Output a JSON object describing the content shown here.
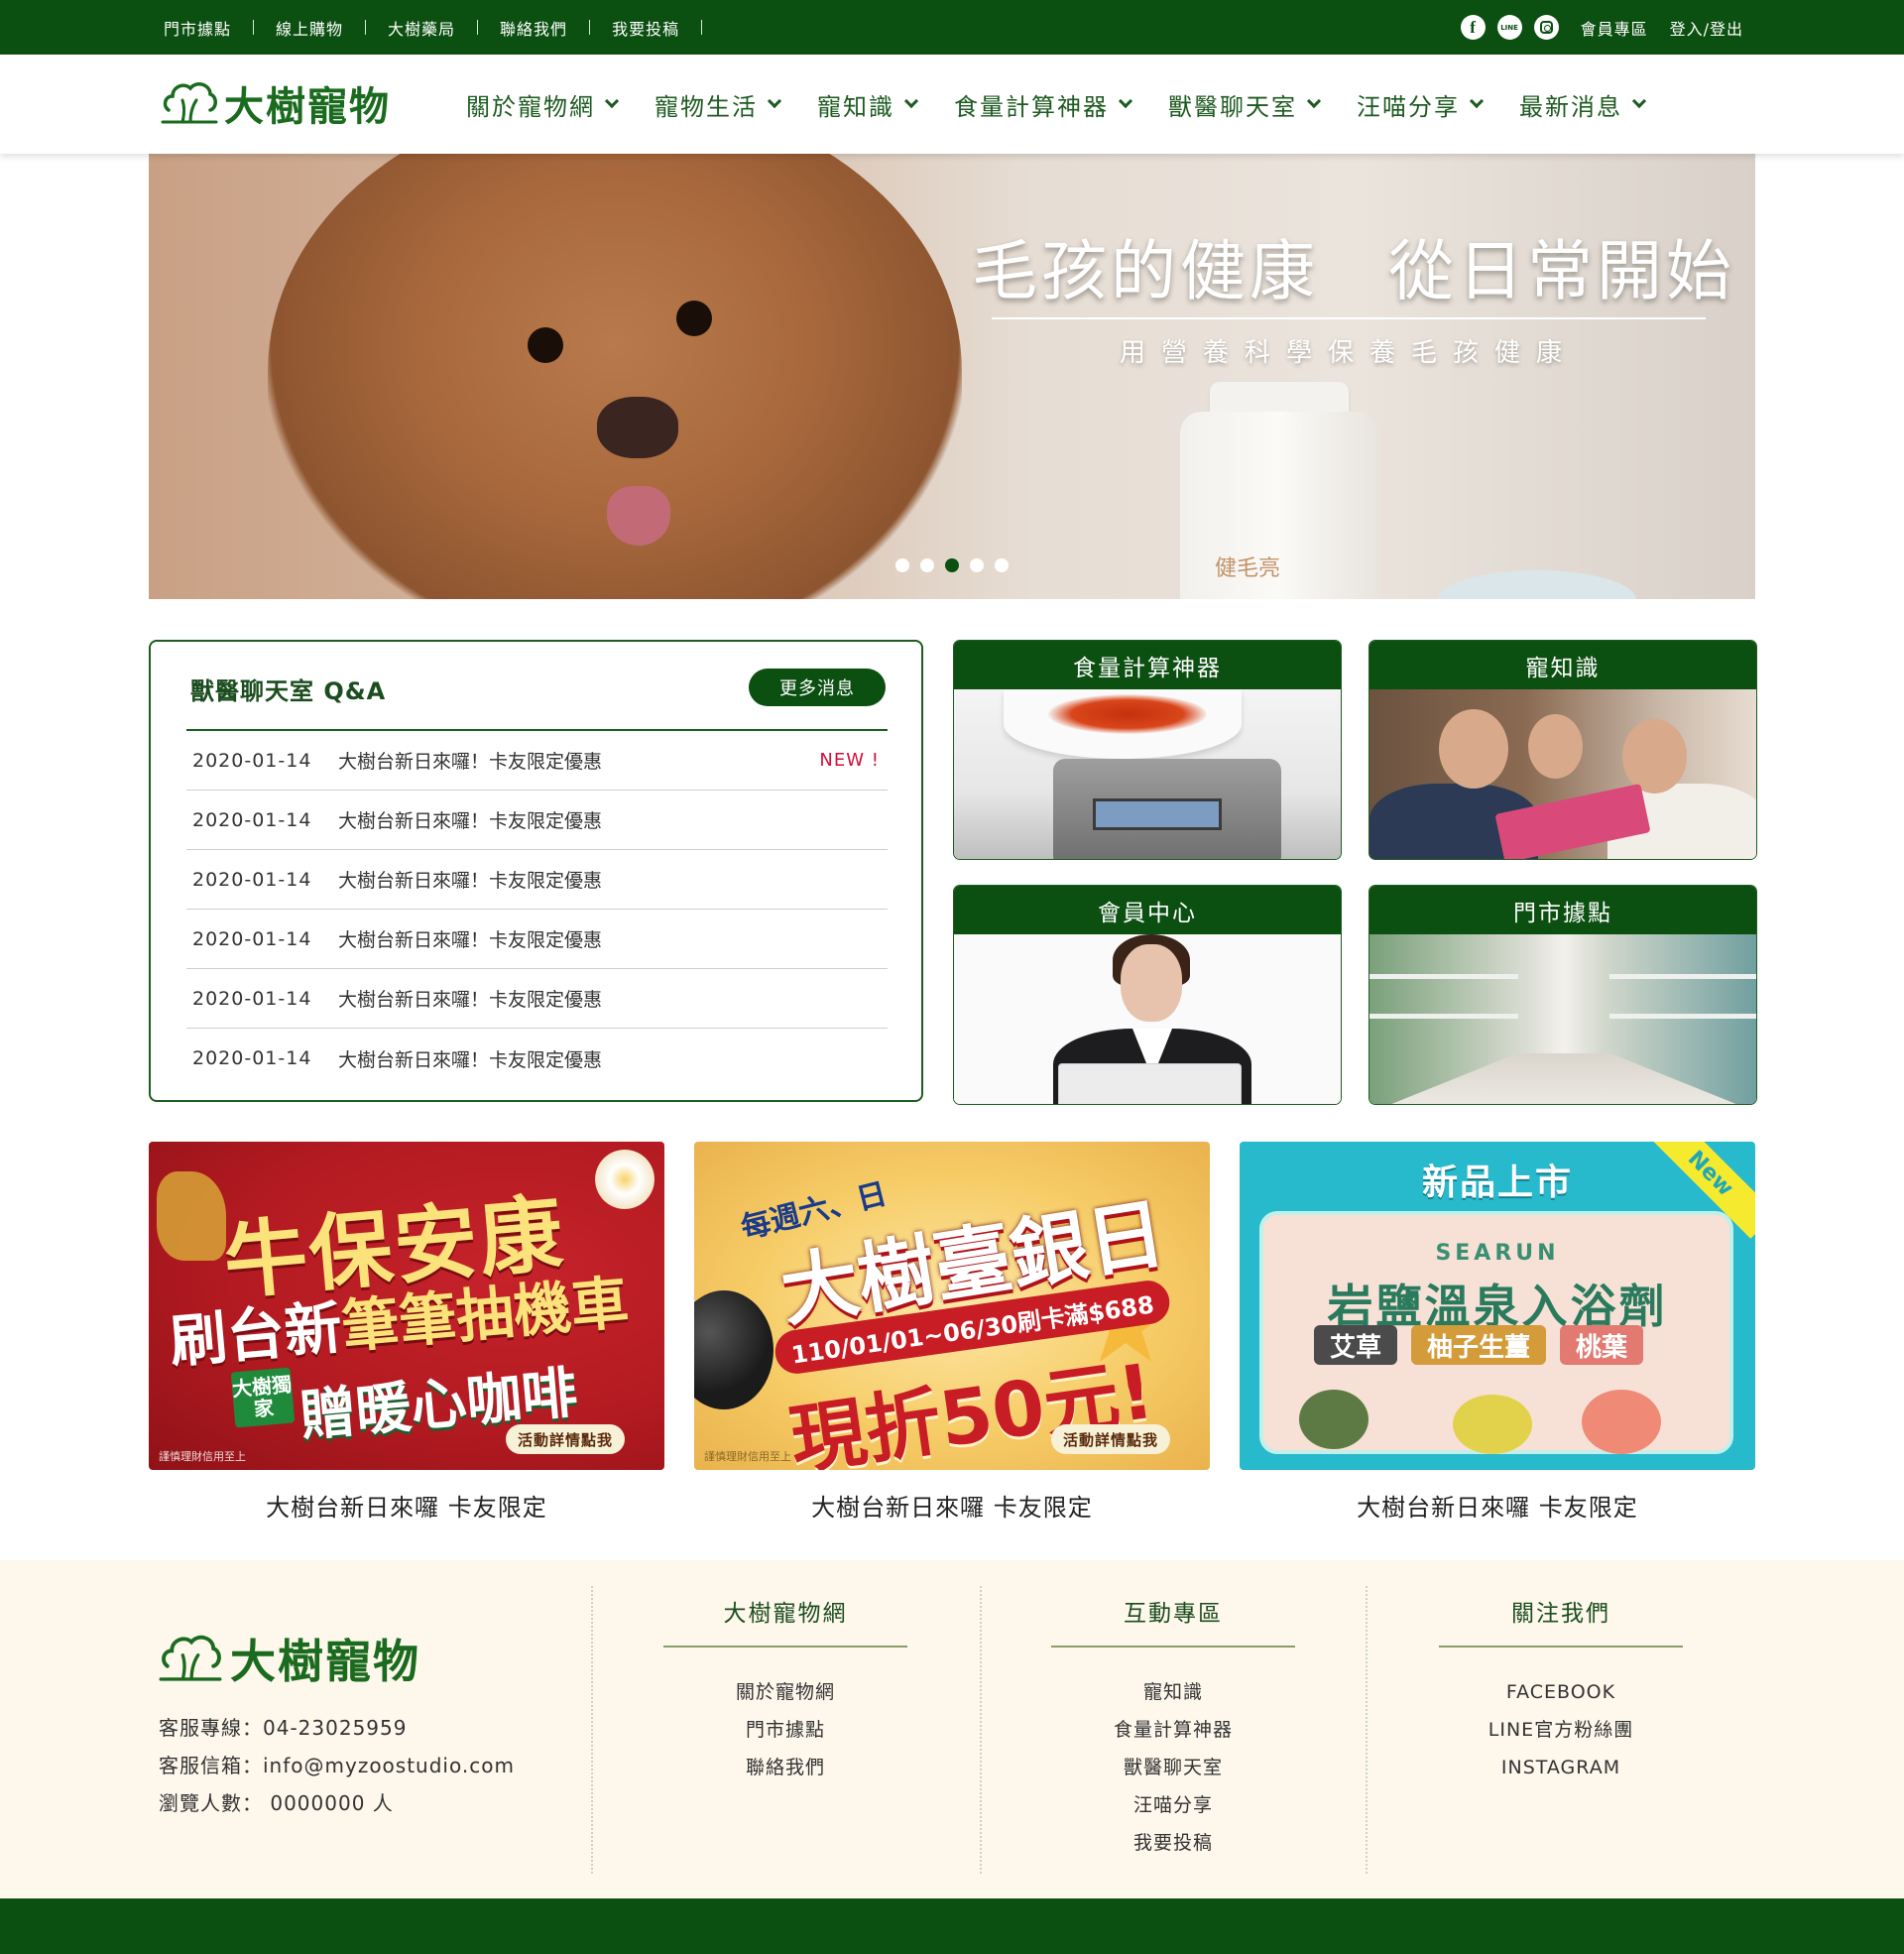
{
  "topbar": {
    "links": [
      "門市據點",
      "線上購物",
      "大樹藥局",
      "聯絡我們",
      "我要投稿"
    ],
    "social": [
      {
        "name": "facebook-icon",
        "glyph": "f"
      },
      {
        "name": "line-icon",
        "glyph": "LINE"
      },
      {
        "name": "instagram-icon",
        "glyph": ""
      }
    ],
    "member": "會員專區",
    "login": "登入/登出"
  },
  "header": {
    "logo_text": "大樹寵物",
    "nav": [
      "關於寵物網",
      "寵物生活",
      "寵知識",
      "食量計算神器",
      "獸醫聊天室",
      "汪喵分享",
      "最新消息"
    ]
  },
  "hero": {
    "headline": "毛孩的健康　從日常開始",
    "subline": "用營養科學保養毛孩健康",
    "bottle_label": "健毛亮",
    "slides": 5,
    "active_slide": 3
  },
  "qa": {
    "title": "獸醫聊天室 Q&A",
    "more": "更多消息",
    "new_badge": "NEW !",
    "rows": [
      {
        "date": "2020-01-14",
        "title": "大樹台新日來囉！卡友限定優惠"
      },
      {
        "date": "2020-01-14",
        "title": "大樹台新日來囉！卡友限定優惠"
      },
      {
        "date": "2020-01-14",
        "title": "大樹台新日來囉！卡友限定優惠"
      },
      {
        "date": "2020-01-14",
        "title": "大樹台新日來囉！卡友限定優惠"
      },
      {
        "date": "2020-01-14",
        "title": "大樹台新日來囉！卡友限定優惠"
      },
      {
        "date": "2020-01-14",
        "title": "大樹台新日來囉！卡友限定優惠"
      }
    ]
  },
  "cards": [
    "食量計算神器",
    "寵知識",
    "會員中心",
    "門市據點"
  ],
  "promos": [
    {
      "caption": "大樹台新日來囉 卡友限定",
      "line1": "牛保安康",
      "line2a": "刷台新",
      "line2b": "筆筆抽機車",
      "tag": "大樹獨家",
      "line3": "贈暖心咖啡",
      "cta": "活動詳情點我",
      "fine": "謹慎理財信用至上"
    },
    {
      "caption": "大樹台新日來囉 卡友限定",
      "line1": "每週六、日",
      "line2": "大樹臺銀日",
      "line3": "110/01/01~06/30刷卡滿$688",
      "line4": "現折50元!",
      "cta": "活動詳情點我",
      "fine": "謹慎理財信用至上"
    },
    {
      "caption": "大樹台新日來囉 卡友限定",
      "top": "新品上市",
      "corner": "New",
      "brand": "SEARUN",
      "line2": "岩鹽溫泉入浴劑",
      "chips": [
        "艾草",
        "柚子生薑",
        "桃葉"
      ]
    }
  ],
  "footer": {
    "logo_text": "大樹寵物",
    "info": [
      "客服專線：04-23025959",
      "客服信箱：info@myzoostudio.com",
      "瀏覽人數： 0000000 人"
    ],
    "columns": [
      {
        "heading": "大樹寵物網",
        "items": [
          "關於寵物網",
          "門市據點",
          "聯絡我們"
        ]
      },
      {
        "heading": "互動專區",
        "items": [
          "寵知識",
          "食量計算神器",
          "獸醫聊天室",
          "汪喵分享",
          "我要投稿"
        ]
      },
      {
        "heading": "關注我們",
        "items": [
          "FACEBOOK",
          "LINE官方粉絲團",
          "INSTAGRAM"
        ]
      }
    ]
  },
  "colors": {
    "brand_green": "#0b4f11",
    "logo_green": "#1b6b1f",
    "new_red": "#d0103a",
    "footer_bg": "#fdf7ec"
  }
}
